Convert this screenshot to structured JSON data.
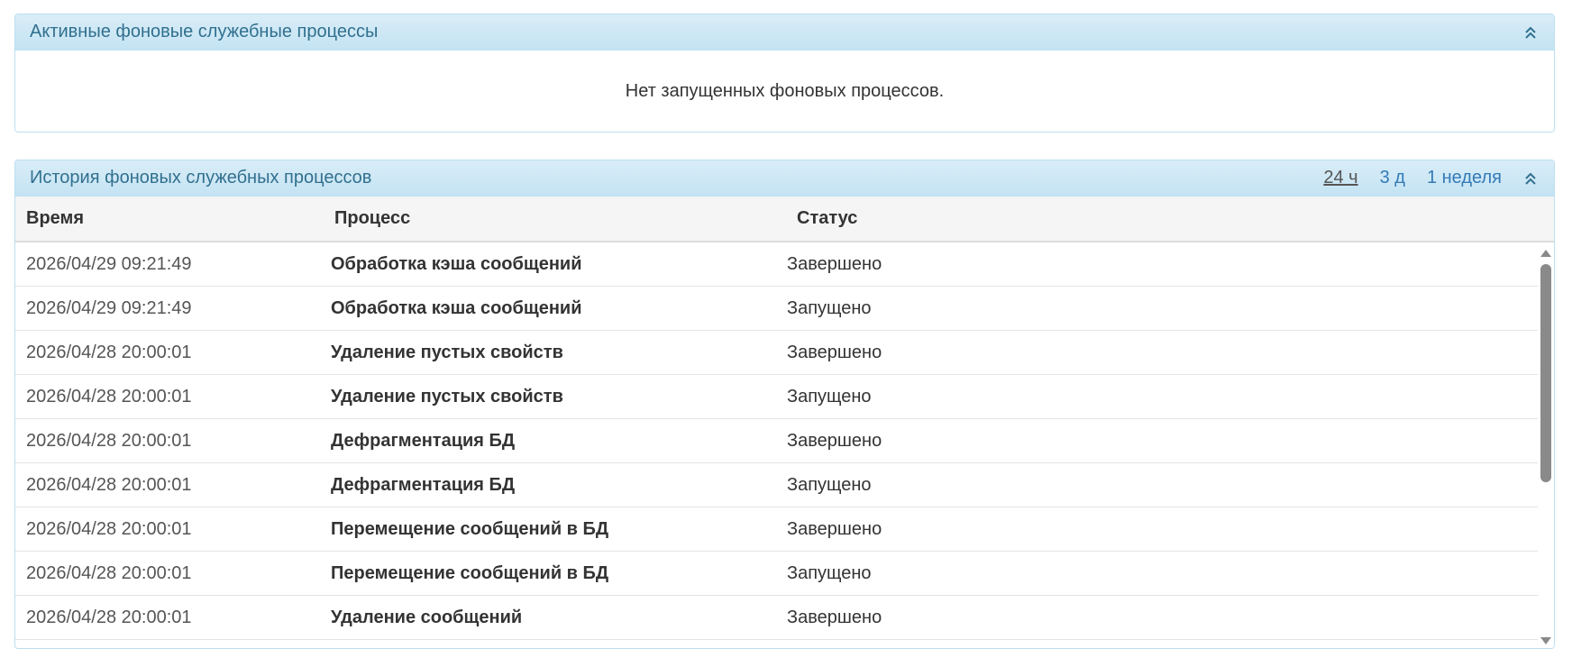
{
  "active_panel": {
    "title": "Активные фоновые служебные процессы",
    "empty_message": "Нет запущенных фоновых процессов."
  },
  "history_panel": {
    "title": "История фоновых служебных процессов",
    "ranges": [
      "24 ч",
      "3 д",
      "1 неделя"
    ],
    "selected_range": "24 ч",
    "columns": {
      "time": "Время",
      "process": "Процесс",
      "status": "Статус"
    },
    "rows": [
      {
        "time": "2026/04/29 09:21:49",
        "process": "Обработка кэша сообщений",
        "status": "Завершено"
      },
      {
        "time": "2026/04/29 09:21:49",
        "process": "Обработка кэша сообщений",
        "status": "Запущено"
      },
      {
        "time": "2026/04/28 20:00:01",
        "process": "Удаление пустых свойств",
        "status": "Завершено"
      },
      {
        "time": "2026/04/28 20:00:01",
        "process": "Удаление пустых свойств",
        "status": "Запущено"
      },
      {
        "time": "2026/04/28 20:00:01",
        "process": "Дефрагментация БД",
        "status": "Завершено"
      },
      {
        "time": "2026/04/28 20:00:01",
        "process": "Дефрагментация БД",
        "status": "Запущено"
      },
      {
        "time": "2026/04/28 20:00:01",
        "process": "Перемещение сообщений в БД",
        "status": "Завершено"
      },
      {
        "time": "2026/04/28 20:00:01",
        "process": "Перемещение сообщений в БД",
        "status": "Запущено"
      },
      {
        "time": "2026/04/28 20:00:01",
        "process": "Удаление сообщений",
        "status": "Завершено"
      }
    ]
  },
  "icons": {
    "collapse": "chevron-double-up-icon"
  },
  "colors": {
    "heading_text": "#31708f",
    "heading_bg": "#d9edf7",
    "link": "#337ab7"
  }
}
